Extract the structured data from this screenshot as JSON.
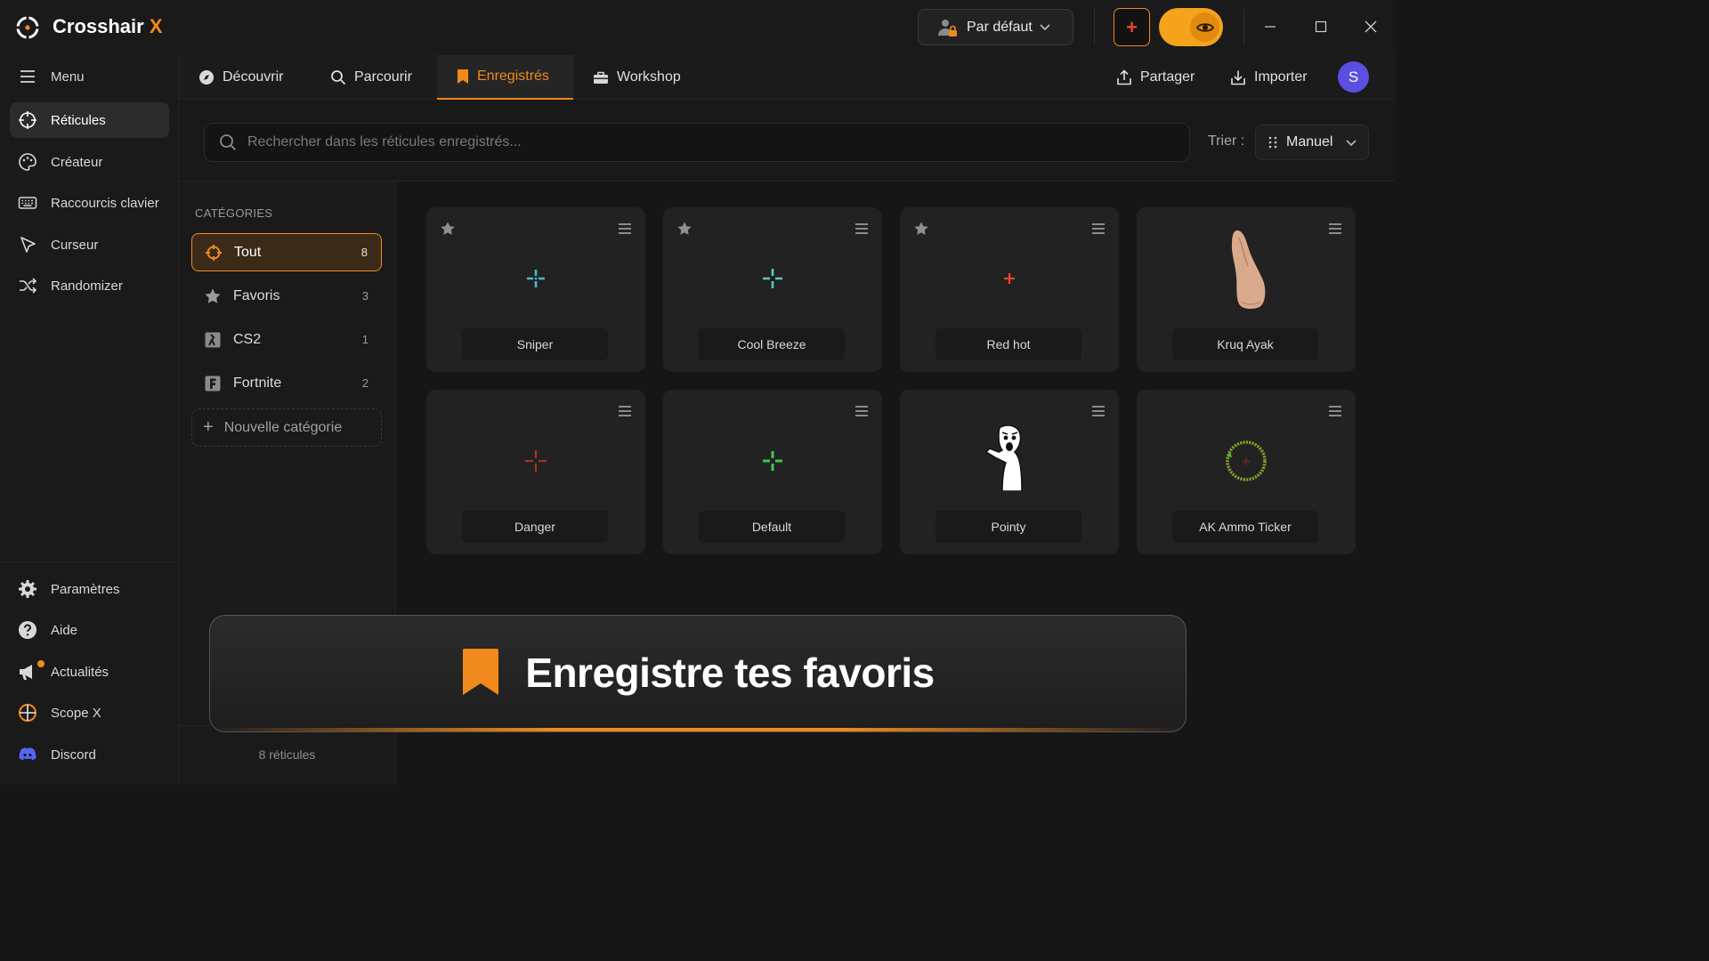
{
  "app": {
    "title": "Crosshair",
    "title_x": "X"
  },
  "titlebar": {
    "profile": "Par défaut"
  },
  "sidebar": {
    "items": [
      {
        "label": "Menu"
      },
      {
        "label": "Réticules"
      },
      {
        "label": "Créateur"
      },
      {
        "label": "Raccourcis clavier"
      },
      {
        "label": "Curseur"
      },
      {
        "label": "Randomizer"
      }
    ],
    "bottom_items": [
      {
        "label": "Paramètres"
      },
      {
        "label": "Aide"
      },
      {
        "label": "Actualités"
      },
      {
        "label": "Scope X"
      },
      {
        "label": "Discord"
      }
    ]
  },
  "tabs": [
    {
      "label": "Découvrir"
    },
    {
      "label": "Parcourir"
    },
    {
      "label": "Enregistrés"
    },
    {
      "label": "Workshop"
    }
  ],
  "header": {
    "share": "Partager",
    "import": "Importer",
    "avatar": "S"
  },
  "search": {
    "placeholder": "Rechercher dans les réticules enregistrés..."
  },
  "sort": {
    "label": "Trier :",
    "value": "Manuel"
  },
  "categories": {
    "title": "CATÉGORIES",
    "items": [
      {
        "label": "Tout",
        "count": "8"
      },
      {
        "label": "Favoris",
        "count": "3"
      },
      {
        "label": "CS2",
        "count": "1"
      },
      {
        "label": "Fortnite",
        "count": "2"
      }
    ],
    "new": "Nouvelle catégorie",
    "footer": "8 réticules"
  },
  "crosshairs": [
    {
      "name": "Sniper",
      "favorite": true
    },
    {
      "name": "Cool Breeze",
      "favorite": true
    },
    {
      "name": "Red hot",
      "favorite": true
    },
    {
      "name": "Kruq Ayak",
      "favorite": false
    },
    {
      "name": "Danger",
      "favorite": false
    },
    {
      "name": "Default",
      "favorite": false
    },
    {
      "name": "Pointy",
      "favorite": false
    },
    {
      "name": "AK Ammo Ticker",
      "favorite": false
    }
  ],
  "toast": {
    "text": "Enregistre tes favoris"
  },
  "colors": {
    "accent": "#f08a1c",
    "avatar": "#5a4fe0",
    "discord": "#5865f2"
  }
}
